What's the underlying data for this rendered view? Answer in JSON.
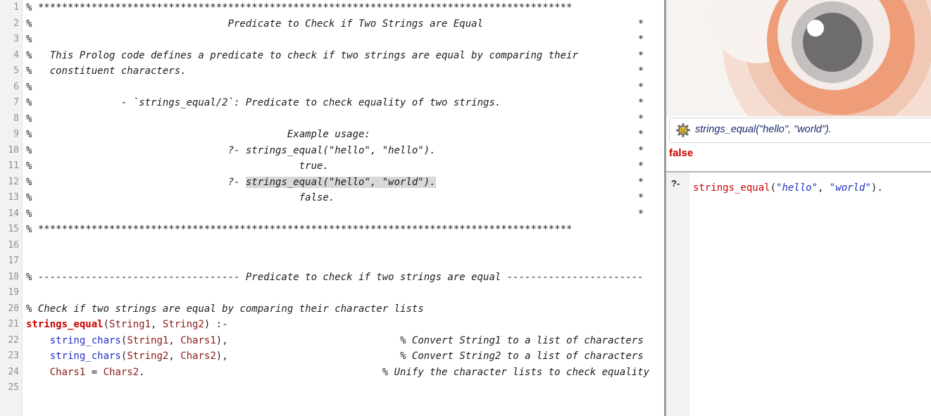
{
  "editor": {
    "lines": [
      {
        "n": "1",
        "segments": [
          {
            "t": "% ******************************************************************************************",
            "c": "cm"
          }
        ]
      },
      {
        "n": "2",
        "segments": [
          {
            "t": "%                                 Predicate to Check if Two Strings are Equal",
            "c": "cm"
          }
        ],
        "star": "*"
      },
      {
        "n": "3",
        "segments": [
          {
            "t": "%",
            "c": "cm"
          }
        ],
        "star": "*"
      },
      {
        "n": "4",
        "segments": [
          {
            "t": "%   This Prolog code defines a predicate to check if two strings are equal by comparing their",
            "c": "cm"
          }
        ],
        "star": "*"
      },
      {
        "n": "5",
        "segments": [
          {
            "t": "%   constituent characters.",
            "c": "cm"
          }
        ],
        "star": "*"
      },
      {
        "n": "6",
        "segments": [
          {
            "t": "%",
            "c": "cm"
          }
        ],
        "star": "*"
      },
      {
        "n": "7",
        "segments": [
          {
            "t": "%               - `strings_equal/2`: Predicate to check equality of two strings.",
            "c": "cm"
          }
        ],
        "star": "*"
      },
      {
        "n": "8",
        "segments": [
          {
            "t": "%",
            "c": "cm"
          }
        ],
        "star": "*"
      },
      {
        "n": "9",
        "segments": [
          {
            "t": "%                                           Example usage:",
            "c": "cm"
          }
        ],
        "star": "*"
      },
      {
        "n": "10",
        "segments": [
          {
            "t": "%                                 ?- strings_equal(\"hello\", \"hello\").",
            "c": "cm"
          }
        ],
        "star": "*"
      },
      {
        "n": "11",
        "segments": [
          {
            "t": "%                                             true.",
            "c": "cm"
          }
        ],
        "star": "*"
      },
      {
        "n": "12",
        "segments": [
          {
            "t": "%                                 ?- ",
            "c": "cm"
          },
          {
            "t": "strings_equal(\"hello\", \"world\").",
            "c": "cm hl"
          }
        ],
        "star": "*"
      },
      {
        "n": "13",
        "segments": [
          {
            "t": "%                                             false.",
            "c": "cm"
          }
        ],
        "star": "*"
      },
      {
        "n": "14",
        "segments": [
          {
            "t": "%",
            "c": "cm"
          }
        ],
        "star": "*"
      },
      {
        "n": "15",
        "segments": [
          {
            "t": "% ******************************************************************************************",
            "c": "cm"
          }
        ]
      },
      {
        "n": "16",
        "segments": []
      },
      {
        "n": "17",
        "segments": []
      },
      {
        "n": "18",
        "segments": [
          {
            "t": "% ---------------------------------- Predicate to check if two strings are equal -----------------------",
            "c": "cm"
          }
        ]
      },
      {
        "n": "19",
        "segments": []
      },
      {
        "n": "20",
        "segments": [
          {
            "t": "% Check if two strings are equal by comparing their character lists",
            "c": "cm"
          }
        ]
      },
      {
        "n": "21",
        "segments": [
          {
            "t": "strings_equal",
            "c": "hd"
          },
          {
            "t": "(",
            "c": "pl"
          },
          {
            "t": "String1",
            "c": "vr"
          },
          {
            "t": ", ",
            "c": "pl"
          },
          {
            "t": "String2",
            "c": "vr"
          },
          {
            "t": ") :-",
            "c": "pl"
          }
        ]
      },
      {
        "n": "22",
        "segments": [
          {
            "t": "    ",
            "c": "pl"
          },
          {
            "t": "string_chars",
            "c": "bi"
          },
          {
            "t": "(",
            "c": "pl"
          },
          {
            "t": "String1",
            "c": "vr"
          },
          {
            "t": ", ",
            "c": "pl"
          },
          {
            "t": "Chars1",
            "c": "vr"
          },
          {
            "t": "),                             ",
            "c": "pl"
          },
          {
            "t": "% Convert String1 to a list of characters",
            "c": "cm"
          }
        ]
      },
      {
        "n": "23",
        "segments": [
          {
            "t": "    ",
            "c": "pl"
          },
          {
            "t": "string_chars",
            "c": "bi"
          },
          {
            "t": "(",
            "c": "pl"
          },
          {
            "t": "String2",
            "c": "vr"
          },
          {
            "t": ", ",
            "c": "pl"
          },
          {
            "t": "Chars2",
            "c": "vr"
          },
          {
            "t": "),                             ",
            "c": "pl"
          },
          {
            "t": "% Convert String2 to a list of characters",
            "c": "cm"
          }
        ]
      },
      {
        "n": "24",
        "segments": [
          {
            "t": "    ",
            "c": "pl"
          },
          {
            "t": "Chars1",
            "c": "vr"
          },
          {
            "t": " = ",
            "c": "pl"
          },
          {
            "t": "Chars2",
            "c": "vr"
          },
          {
            "t": ".                                        ",
            "c": "pl"
          },
          {
            "t": "% Unify the character lists to check equality",
            "c": "cm"
          }
        ]
      },
      {
        "n": "25",
        "segments": []
      }
    ]
  },
  "results": {
    "query_label": "strings_equal(\"hello\", \"world\").",
    "answer": "false",
    "gear_icon": "gear-icon"
  },
  "query_editor": {
    "prompt": "?-",
    "fn": "strings_equal",
    "open": "(",
    "arg1": "\"hello\"",
    "sep": ", ",
    "arg2": "\"world\"",
    "close": ")."
  },
  "colors": {
    "answer_false": "#cc0000",
    "head_predicate": "#cc0000",
    "builtin": "#1f2fc9",
    "variable": "#8b1a1a"
  }
}
